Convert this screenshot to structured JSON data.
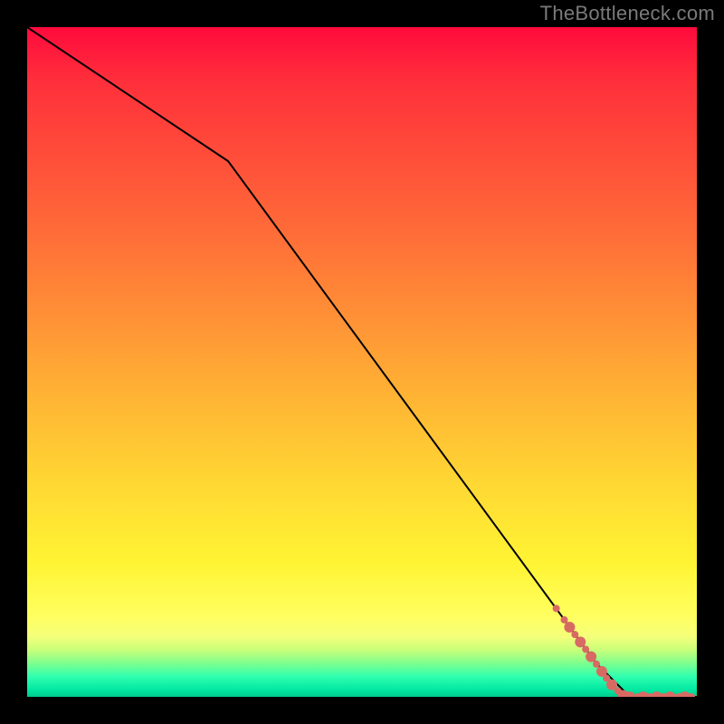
{
  "watermark": "TheBottleneck.com",
  "chart_data": {
    "type": "line",
    "title": "",
    "xlabel": "",
    "ylabel": "",
    "xlim": [
      0,
      100
    ],
    "ylim": [
      0,
      100
    ],
    "series": [
      {
        "name": "bottleneck-curve",
        "x": [
          0,
          30,
          85,
          90,
          100
        ],
        "y": [
          100,
          80,
          5,
          0,
          0
        ],
        "color": "#000000"
      }
    ],
    "scatter": {
      "name": "sample-points",
      "color": "#d86a64",
      "radius_small": 4,
      "radius_large": 6,
      "points": [
        {
          "x": 79.0,
          "y": 13.2,
          "r": "small"
        },
        {
          "x": 80.2,
          "y": 11.5,
          "r": "small"
        },
        {
          "x": 81.0,
          "y": 10.4,
          "r": "large"
        },
        {
          "x": 81.8,
          "y": 9.3,
          "r": "small"
        },
        {
          "x": 82.6,
          "y": 8.2,
          "r": "large"
        },
        {
          "x": 83.4,
          "y": 7.1,
          "r": "small"
        },
        {
          "x": 84.2,
          "y": 6.0,
          "r": "large"
        },
        {
          "x": 85.0,
          "y": 4.9,
          "r": "small"
        },
        {
          "x": 85.8,
          "y": 3.8,
          "r": "large"
        },
        {
          "x": 86.5,
          "y": 2.8,
          "r": "small"
        },
        {
          "x": 87.3,
          "y": 1.8,
          "r": "large"
        },
        {
          "x": 88.2,
          "y": 0.9,
          "r": "small"
        },
        {
          "x": 89.0,
          "y": 0.2,
          "r": "large"
        },
        {
          "x": 90.0,
          "y": 0.0,
          "r": "large"
        },
        {
          "x": 91.2,
          "y": 0.0,
          "r": "small"
        },
        {
          "x": 92.0,
          "y": 0.0,
          "r": "large"
        },
        {
          "x": 93.0,
          "y": 0.0,
          "r": "small"
        },
        {
          "x": 94.0,
          "y": 0.0,
          "r": "large"
        },
        {
          "x": 95.0,
          "y": 0.0,
          "r": "small"
        },
        {
          "x": 96.0,
          "y": 0.0,
          "r": "large"
        },
        {
          "x": 97.3,
          "y": 0.0,
          "r": "small"
        },
        {
          "x": 98.2,
          "y": 0.0,
          "r": "large"
        },
        {
          "x": 99.2,
          "y": 0.0,
          "r": "small"
        }
      ]
    }
  }
}
